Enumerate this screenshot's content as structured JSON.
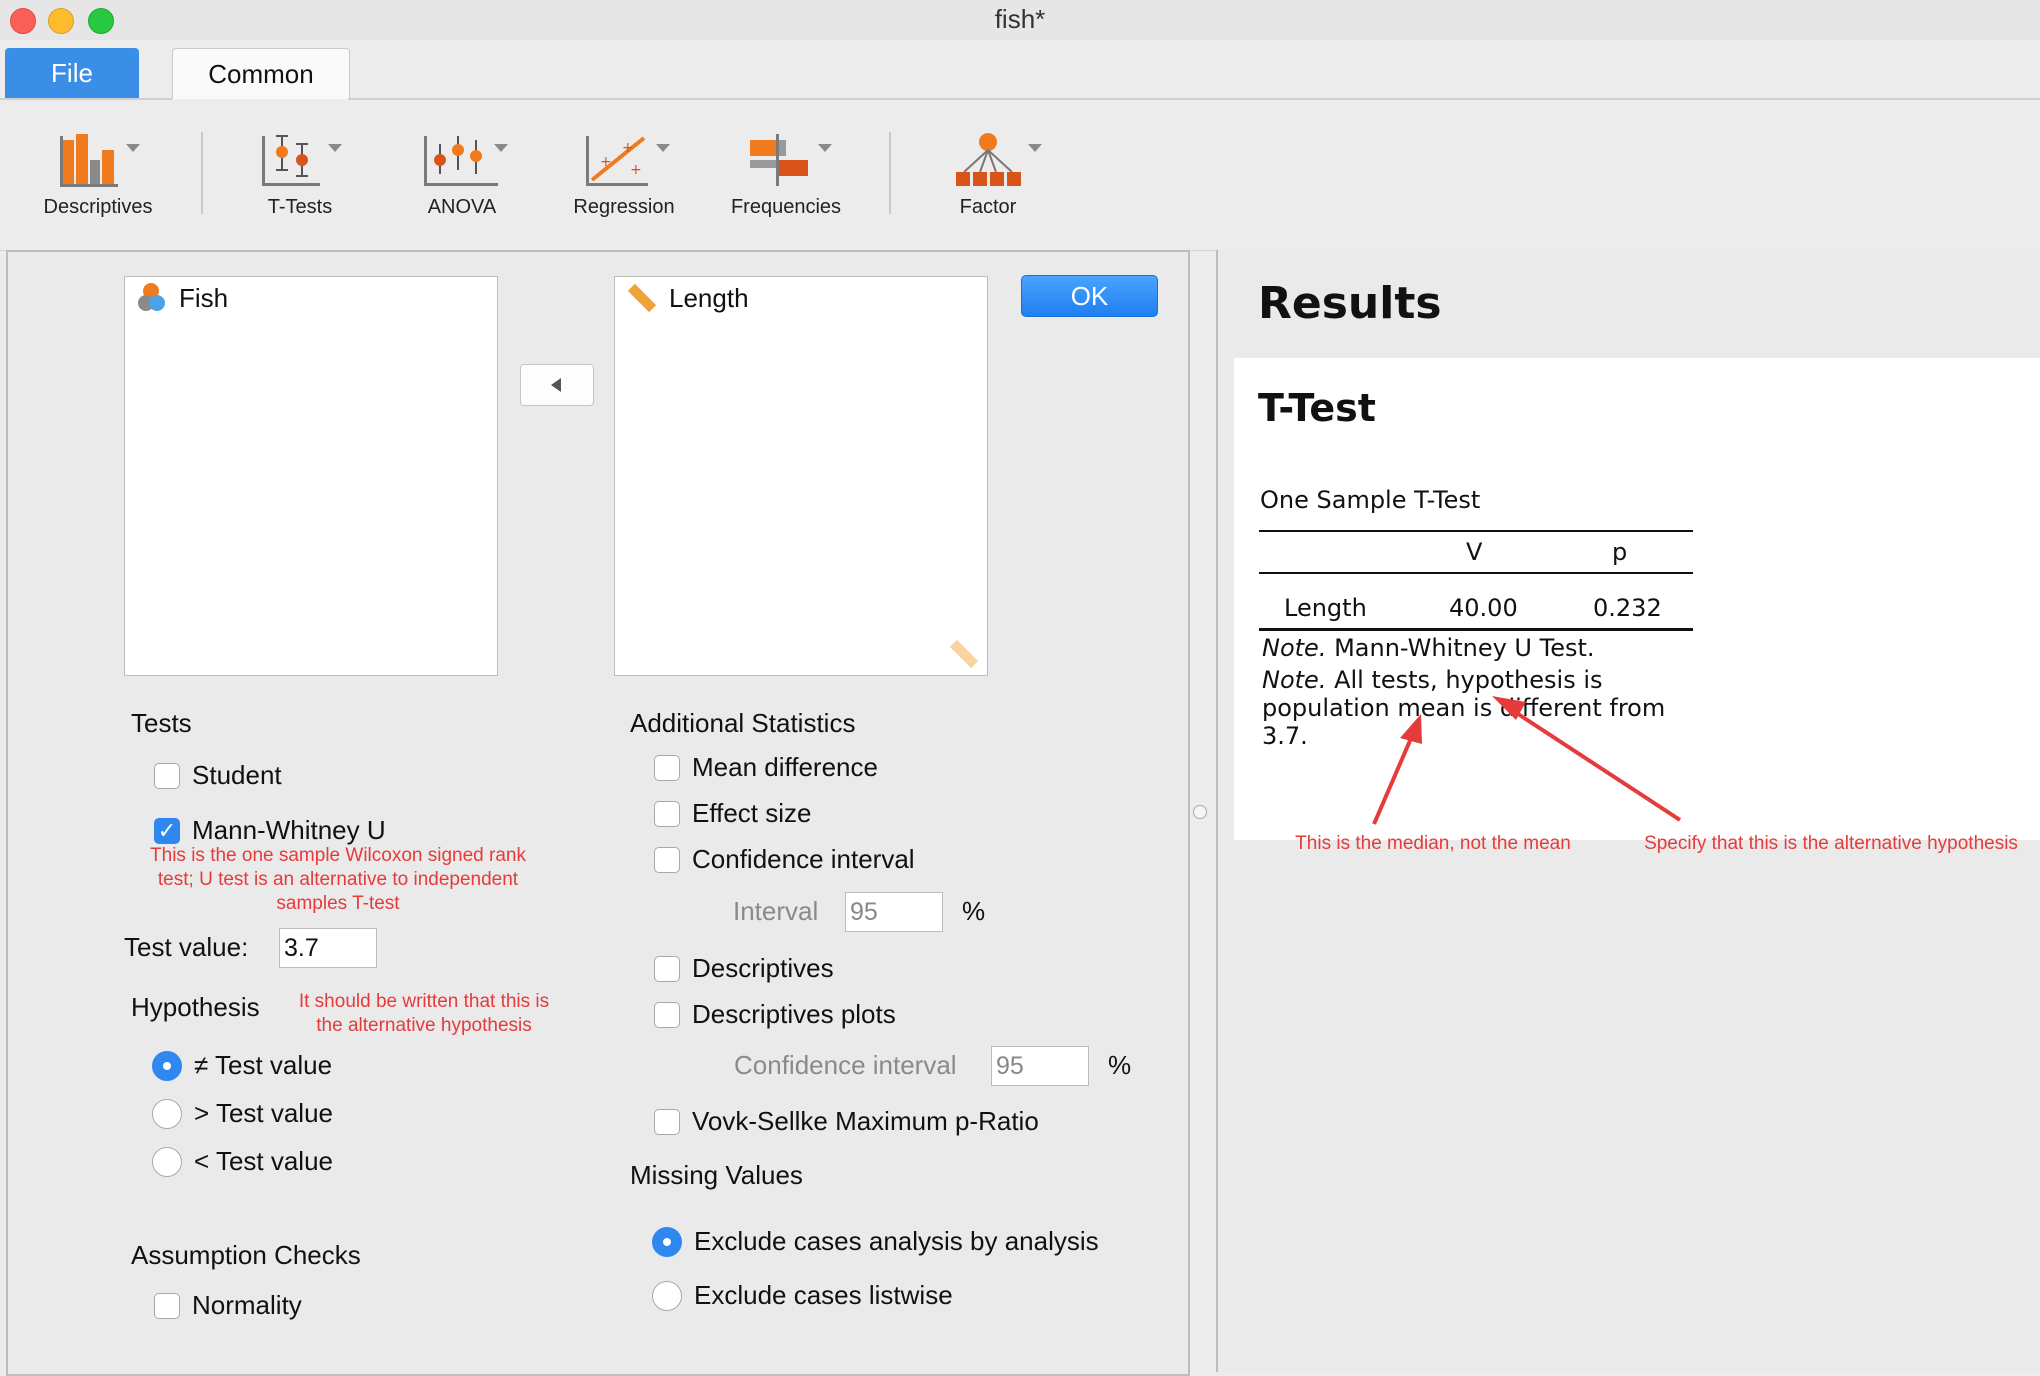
{
  "window": {
    "title": "fish*"
  },
  "tabs": {
    "file": "File",
    "common": "Common"
  },
  "toolbar": {
    "items": [
      {
        "label": "Descriptives",
        "icon": "descriptives-icon"
      },
      {
        "label": "T-Tests",
        "icon": "t-tests-icon"
      },
      {
        "label": "ANOVA",
        "icon": "anova-icon"
      },
      {
        "label": "Regression",
        "icon": "regression-icon"
      },
      {
        "label": "Frequencies",
        "icon": "frequencies-icon"
      },
      {
        "label": "Factor",
        "icon": "factor-icon"
      }
    ]
  },
  "variables": {
    "available": [
      "Fish"
    ],
    "selected": [
      "Length"
    ],
    "ok_label": "OK"
  },
  "tests": {
    "header": "Tests",
    "student": "Student",
    "mann_whitney": "Mann-Whitney U",
    "mann_whitney_checked": true,
    "annotation": "This is the one sample Wilcoxon signed rank test; U test is an alternative to independent samples T-test"
  },
  "test_value": {
    "label": "Test value:",
    "value": "3.7"
  },
  "hypothesis": {
    "header": "Hypothesis",
    "annotation": "It should be written that this is the alternative hypothesis",
    "options": [
      "≠ Test value",
      "> Test value",
      "< Test value"
    ],
    "selected_index": 0
  },
  "assumption_checks": {
    "header": "Assumption Checks",
    "normality": "Normality"
  },
  "additional_statistics": {
    "header": "Additional Statistics",
    "mean_difference": "Mean difference",
    "effect_size": "Effect size",
    "confidence_interval": "Confidence interval",
    "interval_label": "Interval",
    "interval_value": "95",
    "percent": "%",
    "descriptives": "Descriptives",
    "descriptives_plots": "Descriptives plots",
    "plot_ci_label": "Confidence interval",
    "plot_ci_value": "95",
    "vovk_sellke": "Vovk-Sellke Maximum p-Ratio"
  },
  "missing_values": {
    "header": "Missing Values",
    "options": [
      "Exclude cases analysis by analysis",
      "Exclude cases listwise"
    ],
    "selected_index": 0
  },
  "results": {
    "title": "Results",
    "section_title": "T-Test",
    "table_caption": "One Sample T-Test",
    "columns": [
      "",
      "V",
      "p"
    ],
    "rows": [
      {
        "name": "Length",
        "v": "40.00",
        "p": "0.232"
      }
    ],
    "note1_prefix": "Note.",
    "note1_text": " Mann-Whitney U Test.",
    "note2_prefix": "Note.",
    "note2_text": " All tests, hypothesis is population mean is different from 3.7.",
    "annotation_left": "This is the median, not the mean",
    "annotation_right": "Specify that this is the alternative hypothesis"
  },
  "colors": {
    "accent": "#2f87f0",
    "annotation": "#e53b3b",
    "icon_orange": "#f07b1e"
  }
}
